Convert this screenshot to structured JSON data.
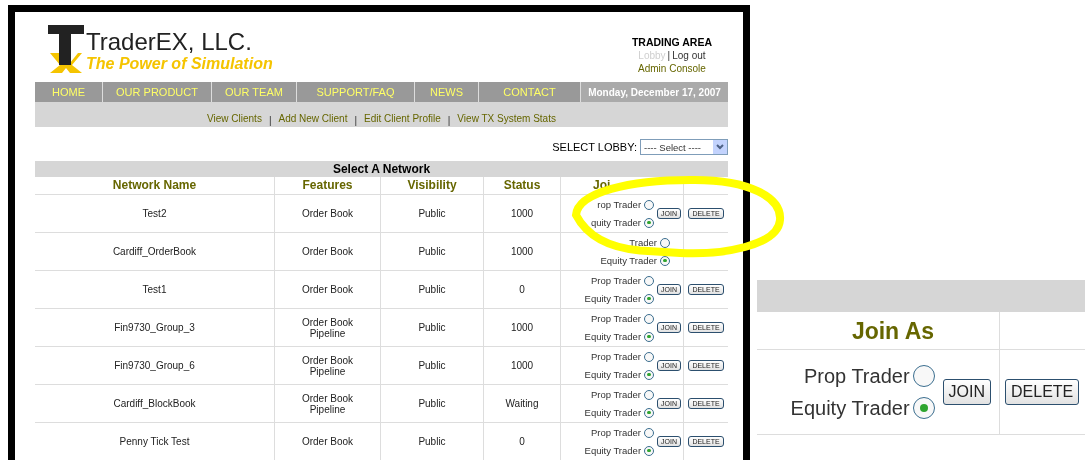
{
  "header": {
    "logo_name": "TraderEX, LLC.",
    "tagline": "The Power of Simulation",
    "area_title": "TRADING AREA",
    "links": [
      {
        "label": "Lobby",
        "disabled": true
      },
      {
        "label": "Log out",
        "disabled": false
      }
    ],
    "link_separator": "|",
    "admin_link": "Admin Console"
  },
  "nav": [
    {
      "label": "HOME"
    },
    {
      "label": "OUR PRODUCT"
    },
    {
      "label": "OUR TEAM"
    },
    {
      "label": "SUPPORT/FAQ"
    },
    {
      "label": "NEWS"
    },
    {
      "label": "CONTACT"
    }
  ],
  "date": "Monday, December 17, 2007",
  "sub_links": [
    "View Clients",
    "Add New Client",
    "Edit Client Profile",
    "View TX System Stats"
  ],
  "sub_separator": "|",
  "lobby": {
    "label": "SELECT LOBBY:",
    "value": "---- Select ----"
  },
  "table": {
    "title": "Select A Network",
    "columns": [
      "Network Name",
      "Features",
      "Visibility",
      "Status",
      "Joi"
    ],
    "rows": [
      {
        "name": "Test2",
        "features": [
          "Order Book"
        ],
        "visibility": "Public",
        "status": "1000",
        "options": [
          {
            "label": "rop Trader",
            "selected": false
          },
          {
            "label": "quity Trader",
            "selected": true
          }
        ],
        "join": "JOIN",
        "delete": "DELETE"
      },
      {
        "name": "Cardiff_OrderBook",
        "features": [
          "Order Book"
        ],
        "visibility": "Public",
        "status": "1000",
        "options": [
          {
            "label": "Trader",
            "selected": false
          },
          {
            "label": "Equity Trader",
            "selected": true
          }
        ]
      },
      {
        "name": "Test1",
        "features": [
          "Order Book"
        ],
        "visibility": "Public",
        "status": "0",
        "options": [
          {
            "label": "Prop Trader",
            "selected": false
          },
          {
            "label": "Equity Trader",
            "selected": true
          }
        ],
        "join": "JOIN",
        "delete": "DELETE"
      },
      {
        "name": "Fin9730_Group_3",
        "features": [
          "Order Book",
          "Pipeline"
        ],
        "visibility": "Public",
        "status": "1000",
        "options": [
          {
            "label": "Prop Trader",
            "selected": false
          },
          {
            "label": "Equity Trader",
            "selected": true
          }
        ],
        "join": "JOIN",
        "delete": "DELETE"
      },
      {
        "name": "Fin9730_Group_6",
        "features": [
          "Order Book",
          "Pipeline"
        ],
        "visibility": "Public",
        "status": "1000",
        "options": [
          {
            "label": "Prop Trader",
            "selected": false
          },
          {
            "label": "Equity Trader",
            "selected": true
          }
        ],
        "join": "JOIN",
        "delete": "DELETE"
      },
      {
        "name": "Cardiff_BlockBook",
        "features": [
          "Order Book",
          "Pipeline"
        ],
        "visibility": "Public",
        "status": "Waiting",
        "options": [
          {
            "label": "Prop Trader",
            "selected": false
          },
          {
            "label": "Equity Trader",
            "selected": true
          }
        ],
        "join": "JOIN",
        "delete": "DELETE"
      },
      {
        "name": "Penny Tick Test",
        "features": [
          "Order Book"
        ],
        "visibility": "Public",
        "status": "0",
        "options": [
          {
            "label": "Prop Trader",
            "selected": false
          },
          {
            "label": "Equity Trader",
            "selected": true
          }
        ],
        "join": "JOIN",
        "delete": "DELETE"
      }
    ]
  },
  "inset": {
    "column": "Join As",
    "options": [
      {
        "label": "Prop Trader",
        "selected": false
      },
      {
        "label": "Equity Trader",
        "selected": true
      }
    ],
    "join": "JOIN",
    "delete": "DELETE"
  }
}
